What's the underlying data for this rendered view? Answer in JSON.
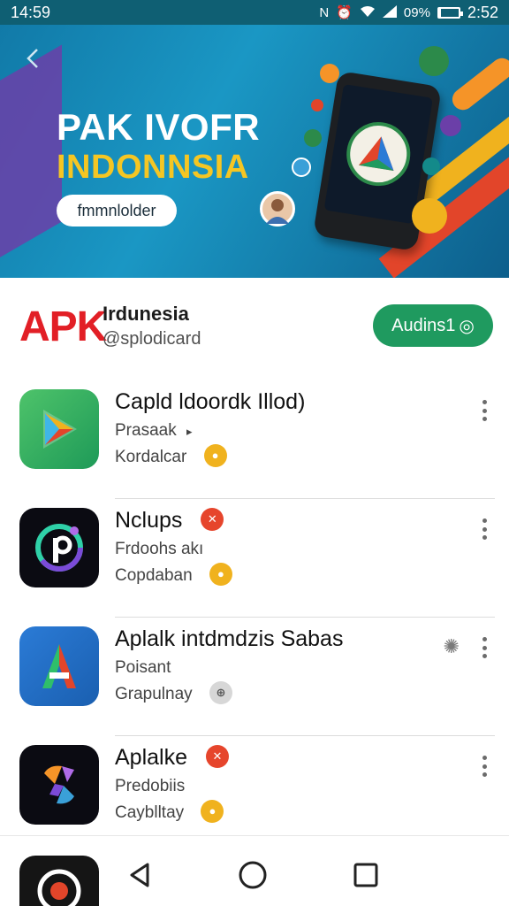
{
  "status_bar": {
    "time_left": "14:59",
    "battery_text": "09%",
    "time_right": "2:52",
    "battery_level": 0.09,
    "icons": [
      "nfc-icon",
      "alarm-icon",
      "wifi-icon",
      "signal-icon",
      "battery-icon"
    ]
  },
  "banner": {
    "title_line1": "PAK IVOFR",
    "title_line2": "INDONNSIA",
    "button_label": "fmmnlolder"
  },
  "header": {
    "logo_text": "APK",
    "title": "Irdunesia",
    "handle": "@splodicard",
    "follow_label": "Audins1",
    "follow_icon_text": "◎"
  },
  "apps": [
    {
      "name": "Capld ldoordk Illod)",
      "line2": "Prasaak",
      "line2_icon": "▸",
      "line3": "Kordalcar",
      "badge": "gold"
    },
    {
      "name": "Nclups",
      "name_badge": "red",
      "line2": "Frdoohs akı",
      "line3": "Copdaban",
      "badge": "gold"
    },
    {
      "name": "Aplalk intdmdzis Sabas",
      "line2": "Poisant",
      "line3": "Grapulnay",
      "badge": "gray",
      "extra_icon": "gear-icon"
    },
    {
      "name": "Aplalke",
      "name_badge": "red",
      "line2": "Predobiis",
      "line3": "Cayblltay",
      "badge": "gold"
    }
  ],
  "colors": {
    "accent_green": "#1f9a5f",
    "apk_red": "#e21f26",
    "status_bar": "#0f5f73",
    "banner_yellow": "#f5c623"
  }
}
